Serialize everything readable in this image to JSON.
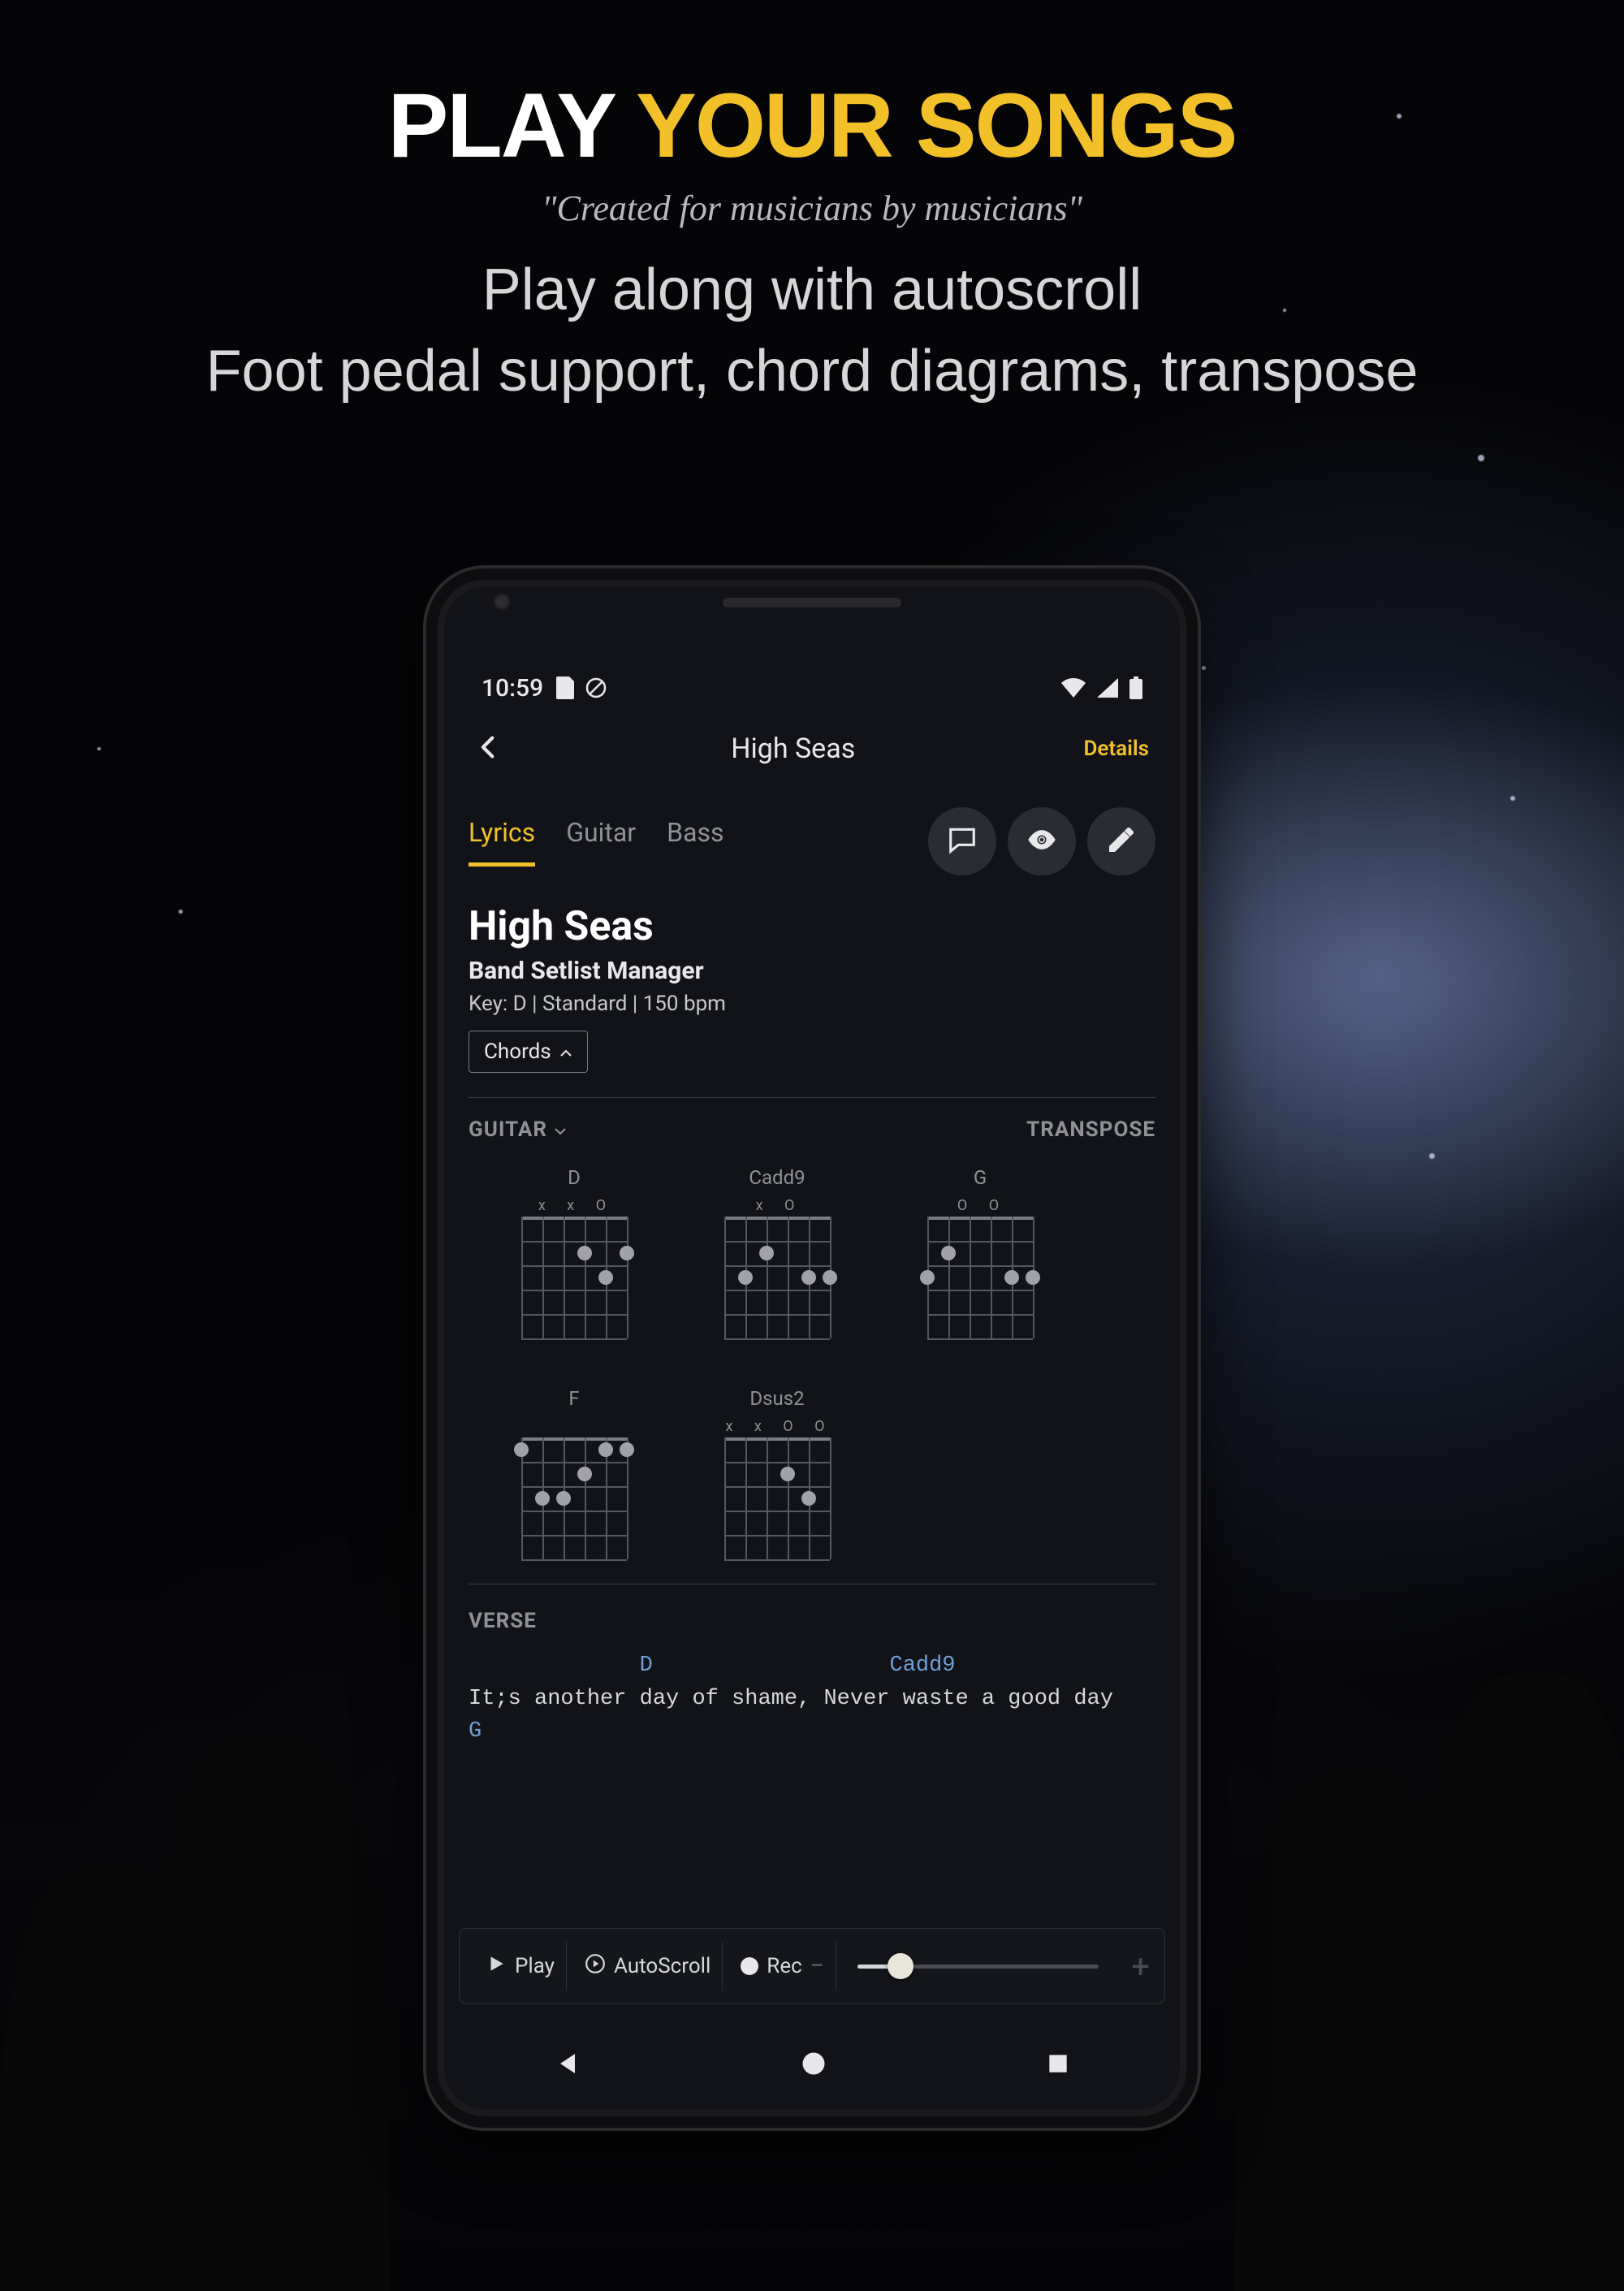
{
  "marketing": {
    "headline_white": "PLAY ",
    "headline_yellow": "YOUR SONGS",
    "quote": "\"Created for musicians by musicians\"",
    "sub1": "Play along with autoscroll",
    "sub2": "Foot pedal support, chord diagrams, transpose"
  },
  "status": {
    "time": "10:59"
  },
  "appbar": {
    "title": "High Seas",
    "details": "Details"
  },
  "tabs": [
    "Lyrics",
    "Guitar",
    "Bass"
  ],
  "song": {
    "title": "High Seas",
    "artist": "Band Setlist Manager",
    "meta": "Key: D | Standard | 150 bpm",
    "chords_button": "Chords"
  },
  "chordhead": {
    "instrument": "GUITAR",
    "transpose": "TRANSPOSE"
  },
  "chords": [
    {
      "name": "D",
      "markers": "x x O"
    },
    {
      "name": "Cadd9",
      "markers": "x   O"
    },
    {
      "name": "G",
      "markers": "    O O"
    },
    {
      "name": "F",
      "markers": ""
    },
    {
      "name": "Dsus2",
      "markers": "x x O   O"
    }
  ],
  "lyrics": {
    "section": "VERSE",
    "chord_line_1_a": "D",
    "chord_line_1_b": "Cadd9",
    "lyric_line_1": "It;s another day of shame, Never waste a good day",
    "chord_line_2": "G"
  },
  "controls": {
    "play": "Play",
    "autoscroll": "AutoScroll",
    "rec": "Rec"
  }
}
